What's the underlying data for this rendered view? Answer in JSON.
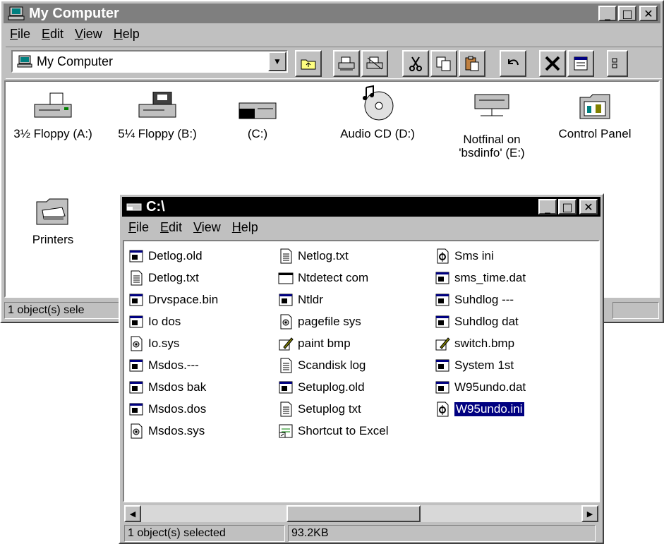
{
  "colors": {
    "face": "#c0c0c0",
    "active_title": "#000000",
    "inactive_title": "#7f7f7f",
    "selection": "#000080"
  },
  "mycomputer": {
    "title": "My Computer",
    "menu": [
      {
        "u": "F",
        "rest": "ile"
      },
      {
        "u": "E",
        "rest": "dit"
      },
      {
        "u": "V",
        "rest": "iew"
      },
      {
        "u": "H",
        "rest": "elp"
      }
    ],
    "address": "My Computer",
    "toolbar_icons": [
      "up-folder-icon",
      "map-drive-icon",
      "disconnect-drive-icon",
      "cut-icon",
      "copy-icon",
      "paste-icon",
      "undo-icon",
      "delete-icon",
      "properties-icon",
      "view-icon"
    ],
    "items": [
      {
        "label": "3½ Floppy (A:)",
        "icon": "floppy-35-drive-icon"
      },
      {
        "label": "5¼ Floppy (B:)",
        "icon": "floppy-525-drive-icon"
      },
      {
        "label": "(C:)",
        "icon": "hard-drive-icon"
      },
      {
        "label": "Audio CD (D:)",
        "icon": "audio-cd-icon"
      },
      {
        "label": "Notfinal on 'bsdinfo' (E:)",
        "icon": "network-drive-icon"
      },
      {
        "label": "Control Panel",
        "icon": "control-panel-icon"
      },
      {
        "label": "Printers",
        "icon": "printers-folder-icon"
      }
    ],
    "status": "1 object(s) sele"
  },
  "cdrive": {
    "title": "C:\\",
    "menu": [
      {
        "u": "F",
        "rest": "ile"
      },
      {
        "u": "E",
        "rest": "dit"
      },
      {
        "u": "V",
        "rest": "iew"
      },
      {
        "u": "H",
        "rest": "elp"
      }
    ],
    "files": [
      {
        "name": "Detlog.old",
        "icon": "app-file-icon"
      },
      {
        "name": "Detlog.txt",
        "icon": "text-file-icon"
      },
      {
        "name": "Drvspace.bin",
        "icon": "app-file-icon"
      },
      {
        "name": "Io dos",
        "icon": "app-file-icon"
      },
      {
        "name": "Io.sys",
        "icon": "system-file-icon"
      },
      {
        "name": "Msdos.---",
        "icon": "app-file-icon"
      },
      {
        "name": "Msdos bak",
        "icon": "app-file-icon"
      },
      {
        "name": "Msdos.dos",
        "icon": "app-file-icon"
      },
      {
        "name": "Msdos.sys",
        "icon": "system-file-icon"
      },
      {
        "name": "Netlog.txt",
        "icon": "text-file-icon"
      },
      {
        "name": "Ntdetect com",
        "icon": "dos-program-icon"
      },
      {
        "name": "Ntldr",
        "icon": "app-file-icon"
      },
      {
        "name": "pagefile sys",
        "icon": "system-file-icon"
      },
      {
        "name": "paint bmp",
        "icon": "paint-bitmap-icon"
      },
      {
        "name": "Scandisk log",
        "icon": "text-file-icon"
      },
      {
        "name": "Setuplog.old",
        "icon": "app-file-icon"
      },
      {
        "name": "Setuplog txt",
        "icon": "text-file-icon"
      },
      {
        "name": "Shortcut to Excel",
        "icon": "shortcut-icon"
      },
      {
        "name": "Sms ini",
        "icon": "settings-file-icon"
      },
      {
        "name": "sms_time.dat",
        "icon": "app-file-icon"
      },
      {
        "name": "Suhdlog ---",
        "icon": "app-file-icon"
      },
      {
        "name": "Suhdlog dat",
        "icon": "app-file-icon"
      },
      {
        "name": "switch.bmp",
        "icon": "paint-bitmap-icon"
      },
      {
        "name": "System 1st",
        "icon": "app-file-icon"
      },
      {
        "name": "W95undo.dat",
        "icon": "app-file-icon"
      },
      {
        "name": "W95undo.ini",
        "icon": "settings-file-icon",
        "selected": true
      }
    ],
    "status_left": "1 object(s) selected",
    "status_size": "93.2KB"
  }
}
